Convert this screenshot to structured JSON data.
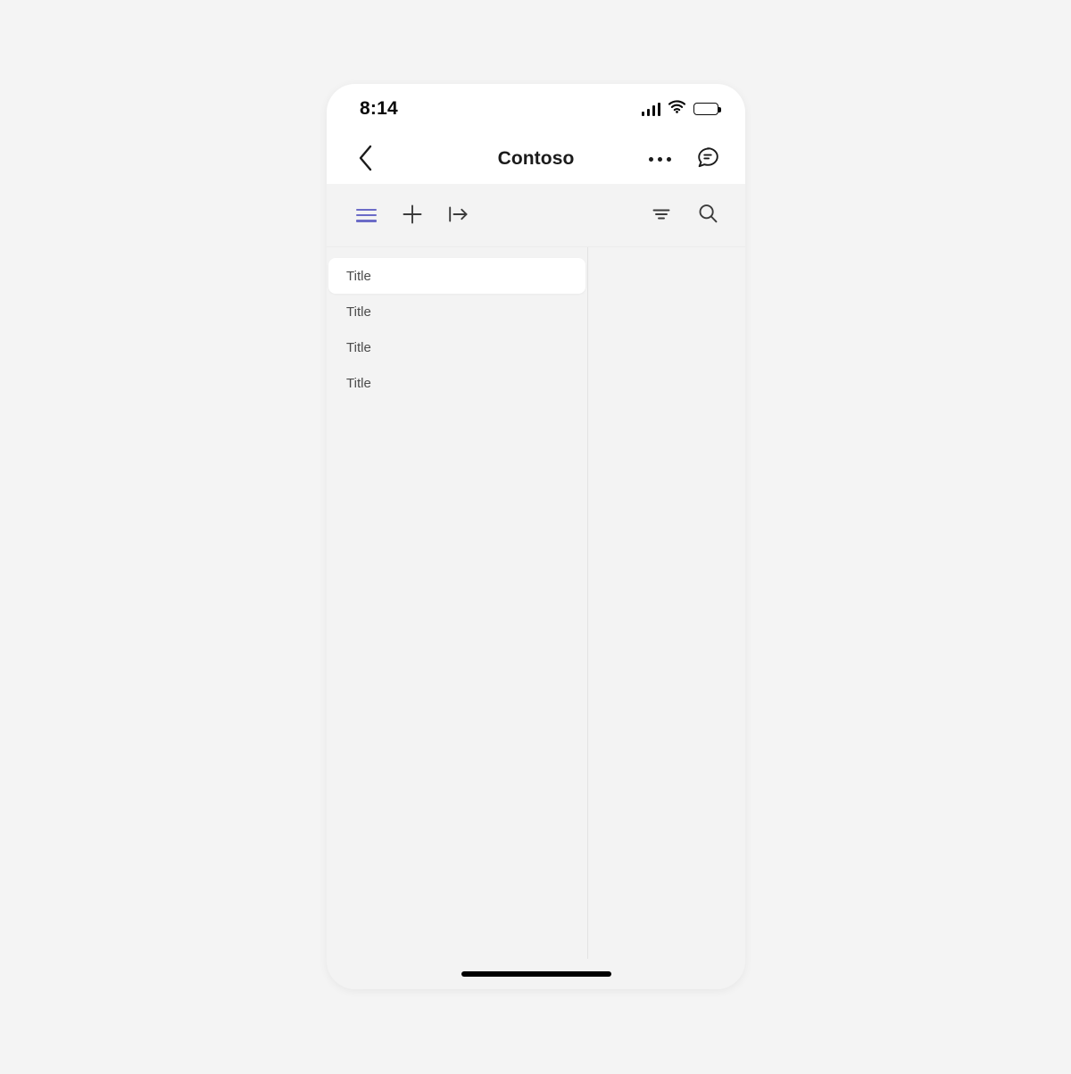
{
  "status_bar": {
    "time": "8:14",
    "signal_icon": "cellular-signal-icon",
    "wifi_icon": "wifi-icon",
    "battery_icon": "battery-full-icon"
  },
  "nav_bar": {
    "back_icon": "chevron-left-icon",
    "title": "Contoso",
    "overflow_icon": "more-horizontal-icon",
    "chat_icon": "chat-bubble-icon"
  },
  "command_bar": {
    "left_actions": [
      {
        "name": "list-view-button",
        "icon": "list-view-icon",
        "label": "List view",
        "active": true
      },
      {
        "name": "add-button",
        "icon": "plus-icon",
        "label": "Add"
      },
      {
        "name": "expand-pane-button",
        "icon": "arrow-to-right-icon",
        "label": "Expand"
      }
    ],
    "right_actions": [
      {
        "name": "filter-button",
        "icon": "filter-icon",
        "label": "Filter"
      },
      {
        "name": "search-button",
        "icon": "search-icon",
        "label": "Search"
      }
    ]
  },
  "list_pane": {
    "items": [
      {
        "label": "Title",
        "selected": true
      },
      {
        "label": "Title",
        "selected": false
      },
      {
        "label": "Title",
        "selected": false
      },
      {
        "label": "Title",
        "selected": false
      }
    ]
  },
  "detail_pane": {
    "content": ""
  },
  "home_indicator": {
    "name": "home-indicator"
  },
  "colors": {
    "page_background": "#f4f4f4",
    "phone_background": "#f3f3f3",
    "header_background": "#ffffff",
    "accent": "#6b6bc7",
    "selected_item_background": "#ffffff",
    "text_primary": "#1b1b1b",
    "text_secondary": "#4b4b4b",
    "divider": "#e3e3e3",
    "home_indicator": "#000000"
  }
}
